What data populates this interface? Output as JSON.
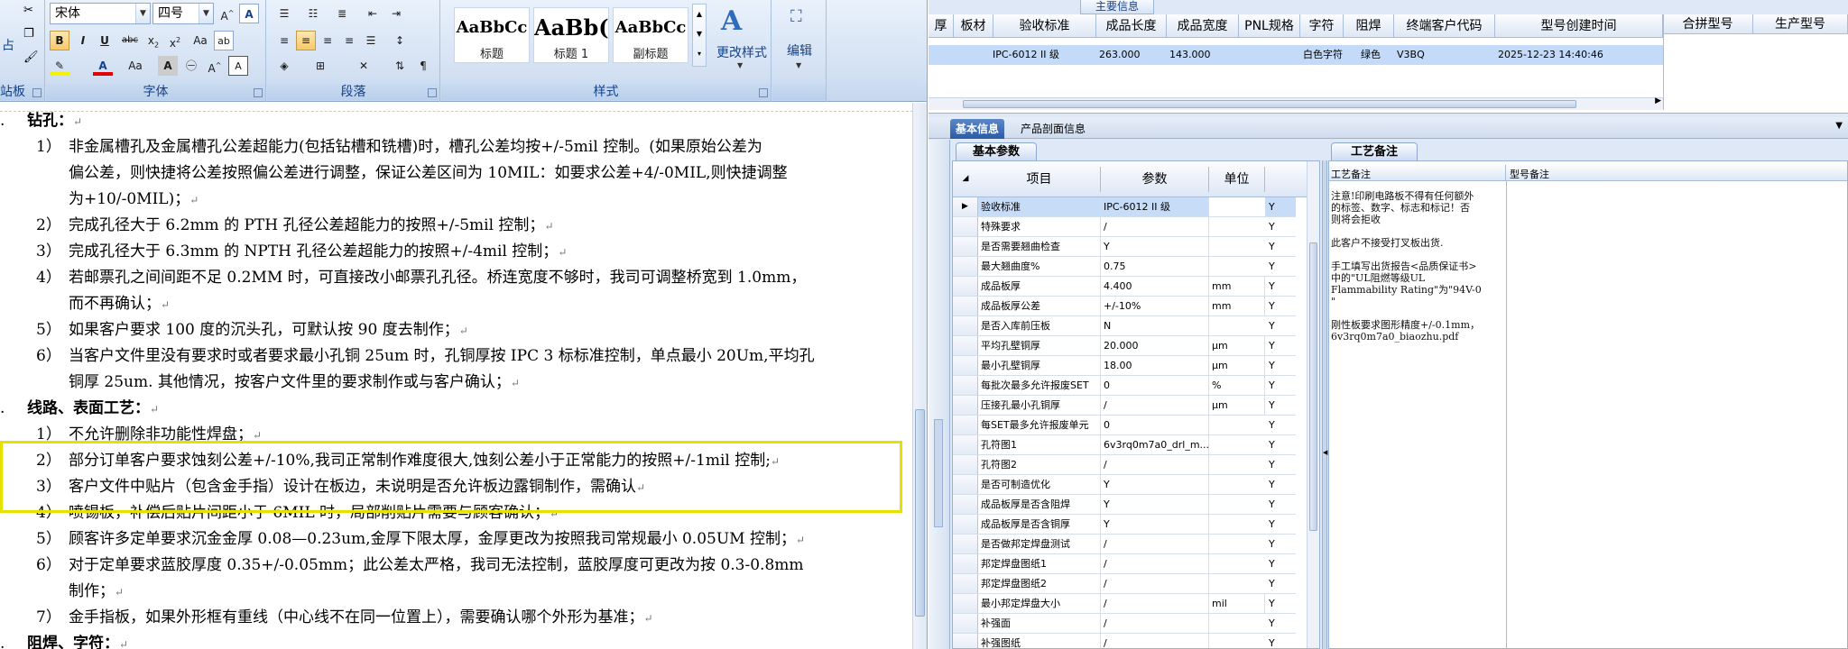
{
  "word": {
    "font_name": "宋体",
    "font_size": "四号",
    "groups": {
      "clipboard_partial": "站板",
      "font": "字体",
      "paragraph": "段落",
      "styles": "样式",
      "editing_partial": ""
    },
    "styles": [
      {
        "sample": "AaBbCc",
        "name": "标题"
      },
      {
        "sample": "AaBb(",
        "name": "标题 1"
      },
      {
        "sample": "AaBbCc",
        "name": "副标题"
      }
    ],
    "change_styles_label": "更改样式",
    "edit_label": "编辑",
    "paste_partial": "占",
    "doc_lines": [
      {
        "text": "钻孔：",
        "para": "↵",
        "num": "."
      },
      {
        "num": "1）",
        "text": "非金属槽孔及金属槽孔公差超能力(包括钻槽和铣槽)时，槽孔公差均按+/-5mil 控制。(如果原始公差为"
      },
      {
        "text": "偏公差，则快捷将公差按照偏公差进行调整，保证公差区间为 10MIL：如要求公差+4/-0MIL,则快捷调整"
      },
      {
        "text": "为+10/-0MIL)；",
        "para": "↵"
      },
      {
        "num": "2）",
        "text": "完成孔径大于 6.2mm 的 PTH 孔径公差超能力的按照+/-5mil 控制；",
        "para": "↵"
      },
      {
        "num": "3）",
        "text": "完成孔径大于 6.3mm 的 NPTH 孔径公差超能力的按照+/-4mil 控制；",
        "para": "↵"
      },
      {
        "num": "4）",
        "text": "若邮票孔之间间距不足 0.2MM 时，可直接改小邮票孔孔径。桥连宽度不够时，我司可调整桥宽到 1.0mm，"
      },
      {
        "text": "而不再确认；",
        "para": "↵"
      },
      {
        "num": "5）",
        "text": "如果客户要求 100 度的沉头孔，可默认按 90 度去制作；",
        "para": "↵"
      },
      {
        "num": "6）",
        "text": "当客户文件里没有要求时或者要求最小孔铜 25um 时，孔铜厚按 IPC 3 标标准控制，单点最小 20Um,平均孔"
      },
      {
        "text": "铜厚 25um. 其他情况，按客户文件里的要求制作或与客户确认；",
        "para": "↵"
      },
      {
        "text": "线路、表面工艺：",
        "para": "↵",
        "num": "."
      },
      {
        "num": "1）",
        "text": "不允许删除非功能性焊盘；",
        "para": "↵"
      },
      {
        "num": "2）",
        "text": "部分订单客户要求蚀刻公差+/-10%,我司正常制作难度很大,蚀刻公差小于正常能力的按照+/-1mil 控制;",
        "para": "↵"
      },
      {
        "num": "3）",
        "text": "客户文件中贴片（包含金手指）设计在板边，未说明是否允许板边露铜制作，需确认",
        "para": "↵"
      },
      {
        "num": "4）",
        "text": "喷锡板，补偿后贴片间距小于 6MIL 时，局部削贴片需要与顾客确认；",
        "para": "↵"
      },
      {
        "num": "5）",
        "text": "顾客许多定单要求沉金金厚 0.08—0.23um,金厚下限太厚，金厚更改为按照我司常规最小 0.05UM 控制；",
        "para": "↵"
      },
      {
        "num": "6）",
        "text": "对于定单要求蓝胶厚度 0.35+/-0.05mm；此公差太严格，我司无法控制，蓝胶厚度可更改为按 0.3-0.8mm"
      },
      {
        "text": "制作；",
        "para": "↵"
      },
      {
        "num": "7）",
        "text": "金手指板，如果外形框有重线（中心线不在同一位置上），需要确认哪个外形为基准；",
        "para": "↵"
      },
      {
        "text": "阻焊、字符：",
        "para": "↵",
        "num": "."
      }
    ]
  },
  "erp": {
    "top_caption": "主要信息",
    "columns": [
      "厚",
      "板材",
      "验收标准",
      "成品长度",
      "成品宽度",
      "PNL规格",
      "字符",
      "阻焊",
      "终端客户代码",
      "型号创建时间",
      "合拼型号",
      "生产型号"
    ],
    "row": {
      "acceptance": "IPC-6012 II 级",
      "length": "263.000",
      "width": "143.000",
      "silkscreen": "白色字符",
      "soldermask": "绿色",
      "end_customer": "V3BQ",
      "created": "2025-12-23 14:40:46"
    },
    "tabs": [
      "基本信息",
      "产品剖面信息"
    ],
    "subtab_params": "基本参数",
    "subtab_notes": "工艺备注",
    "grid_headers": {
      "item": "项目",
      "param": "参数",
      "unit": "单位"
    },
    "params": [
      {
        "item": "验收标准",
        "param": "IPC-6012 II 级",
        "unit": "",
        "y": "Y",
        "current": true
      },
      {
        "item": "特殊要求",
        "param": "/",
        "unit": "",
        "y": "Y"
      },
      {
        "item": "是否需要翘曲检查",
        "param": "Y",
        "unit": "",
        "y": "Y"
      },
      {
        "item": "最大翘曲度%",
        "param": "0.75",
        "unit": "",
        "y": "Y"
      },
      {
        "item": "成品板厚",
        "param": "4.400",
        "unit": "mm",
        "y": "Y"
      },
      {
        "item": "成品板厚公差",
        "param": "+/-10%",
        "unit": "mm",
        "y": "Y"
      },
      {
        "item": "是否入库前压板",
        "param": "N",
        "unit": "",
        "y": "Y"
      },
      {
        "item": "平均孔壁铜厚",
        "param": "20.000",
        "unit": "μm",
        "y": "Y"
      },
      {
        "item": "最小孔壁铜厚",
        "param": "18.00",
        "unit": "μm",
        "y": "Y"
      },
      {
        "item": "每批次最多允许报废SET",
        "param": "0",
        "unit": "%",
        "y": "Y"
      },
      {
        "item": "压接孔最小孔铜厚",
        "param": "/",
        "unit": "μm",
        "y": "Y"
      },
      {
        "item": "每SET最多允许报废单元",
        "param": "0",
        "unit": "",
        "y": "Y"
      },
      {
        "item": "孔符图1",
        "param": "6v3rq0m7a0_drl_m...",
        "unit": "",
        "y": "Y"
      },
      {
        "item": "孔符图2",
        "param": "/",
        "unit": "",
        "y": "Y"
      },
      {
        "item": "是否可制造优化",
        "param": "Y",
        "unit": "",
        "y": "Y"
      },
      {
        "item": "成品板厚是否含阻焊",
        "param": "Y",
        "unit": "",
        "y": "Y"
      },
      {
        "item": "成品板厚是否含铜厚",
        "param": "Y",
        "unit": "",
        "y": "Y"
      },
      {
        "item": "是否做邦定焊盘测试",
        "param": "/",
        "unit": "",
        "y": "Y"
      },
      {
        "item": "邦定焊盘图纸1",
        "param": "/",
        "unit": "",
        "y": "Y"
      },
      {
        "item": "邦定焊盘图纸2",
        "param": "/",
        "unit": "",
        "y": "Y"
      },
      {
        "item": "最小邦定焊盘大小",
        "param": "/",
        "unit": "mil",
        "y": "Y"
      },
      {
        "item": "补强面",
        "param": "/",
        "unit": "",
        "y": "Y"
      },
      {
        "item": "补强图纸",
        "param": "/",
        "unit": "",
        "y": "Y"
      }
    ],
    "notes_header": "工艺备注",
    "model_notes_header": "型号备注",
    "notes_text": "注意!印刷电路板不得有任何额外\n的标签、数字、标志和标记！否\n则将会拒收\n\n此客户不接受打叉板出货.\n\n手工填写出货报告<品质保证书>\n中的\"UL阻燃等级UL\nFlammability Rating\"为\"94V-0\n\"\n\n刚性板要求图形精度+/-0.1mm，\n6v3rq0m7a0_biaozhu.pdf"
  }
}
